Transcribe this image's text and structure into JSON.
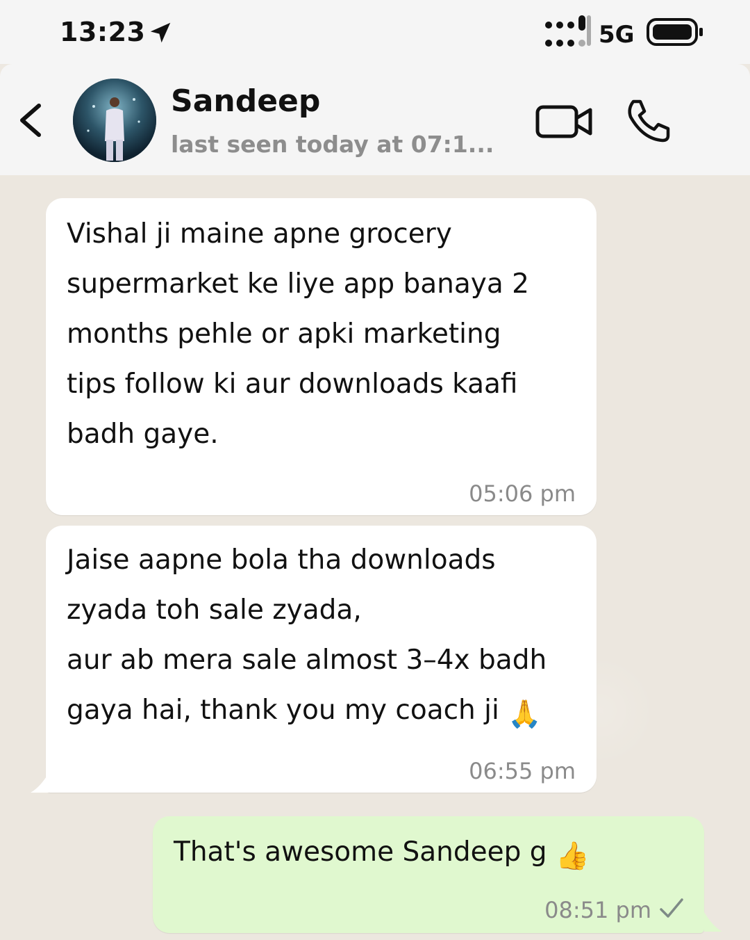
{
  "status_bar": {
    "time": "13:23",
    "network": "5G",
    "icons": [
      "location-arrow-icon",
      "signal-icon",
      "battery-icon"
    ]
  },
  "header": {
    "contact_name": "Sandeep",
    "last_seen": "last seen today at 07:1...",
    "icons": [
      "back-chevron-icon",
      "video-call-icon",
      "phone-icon"
    ]
  },
  "messages": [
    {
      "direction": "incoming",
      "text": "Vishal ji maine apne grocery\nsupermarket ke liye app banaya 2\nmonths pehle or apki marketing\ntips follow ki aur downloads kaafi\nbadh gaye.",
      "time": "05:06 pm"
    },
    {
      "direction": "incoming",
      "text_main": "Jaise aapne bola tha downloads\nzyada toh sale zyada,\naur ab mera sale almost 3–4x badh\ngaya hai, thank you my coach ji ",
      "emoji": "🙏",
      "emoji_icon": "folded-hands-emoji-icon",
      "time": "06:55 pm"
    },
    {
      "direction": "outgoing",
      "text_main": "That's awesome Sandeep g ",
      "emoji": "👍",
      "emoji_icon": "thumbs-up-emoji-icon",
      "time": "08:51 pm",
      "status": "sent-check-icon"
    }
  ],
  "colors": {
    "incoming_bubble": "#ffffff",
    "outgoing_bubble": "#e0f8cf",
    "chat_background": "#ece7df",
    "header_background": "#f5f5f5",
    "muted_text": "#8a8a8a"
  }
}
